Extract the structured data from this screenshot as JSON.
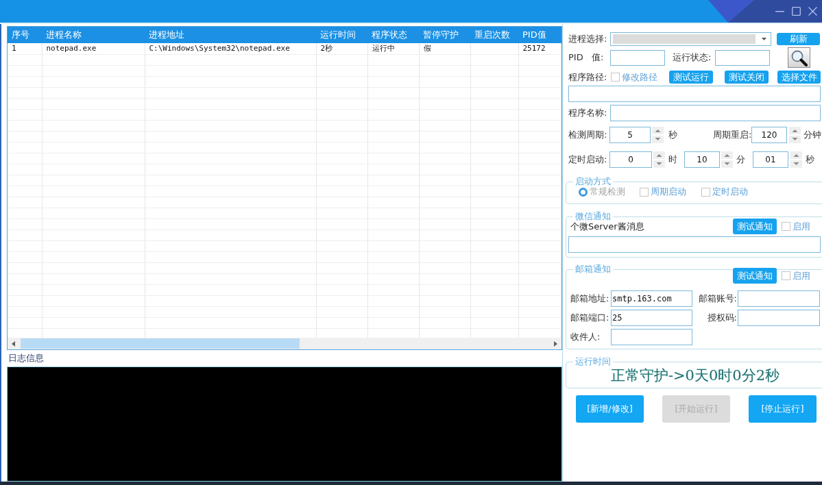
{
  "process_table": {
    "columns": [
      "序号",
      "进程名称",
      "进程地址",
      "运行时间",
      "程序状态",
      "暂停守护",
      "重启次数",
      "PID值"
    ],
    "rows": [
      [
        "1",
        "notepad.exe",
        "C:\\Windows\\System32\\notepad.exe",
        "2秒",
        "运行中",
        "假",
        null,
        "25172"
      ]
    ]
  },
  "log": {
    "label": "日志信息"
  },
  "settings": {
    "process_select": {
      "label": "进程选择:"
    },
    "refresh_button": "刷新",
    "pid": {
      "label": "PID   值:"
    },
    "run_status": {
      "label": "运行状态:"
    },
    "program_path": {
      "label": "程序路径:",
      "modify_path": {
        "label": "修改路径",
        "checked": false
      },
      "buttons": [
        "测试运行",
        "测试关闭",
        "选择文件"
      ]
    },
    "program_name": {
      "label": "程序名称:"
    },
    "check_interval": {
      "label": "检测周期:",
      "value": "5",
      "unit": "秒"
    },
    "periodic_restart": {
      "label": "周期重启:",
      "value": "120",
      "unit": "分钟"
    },
    "scheduled_start": {
      "label": "定时启动:",
      "fields": [
        {
          "value": "0",
          "unit": "时"
        },
        {
          "value": "10",
          "unit": "分"
        },
        {
          "value": "01",
          "unit": "秒"
        }
      ]
    }
  },
  "start_mode": {
    "title": "启动方式",
    "options": [
      {
        "kind": "radio",
        "label": "常规检测",
        "selected": true,
        "disabled": true
      },
      {
        "kind": "checkbox",
        "label": "周期启动",
        "checked": false,
        "disabled": false
      },
      {
        "kind": "checkbox",
        "label": "定时启动",
        "checked": false,
        "disabled": false
      }
    ]
  },
  "wechat_notify": {
    "title": "微信通知",
    "caption": "个微Server酱消息",
    "test_button": "测试通知",
    "enable": {
      "label": "启用",
      "checked": false
    }
  },
  "email_notify": {
    "title": "邮箱通知",
    "test_button": "测试通知",
    "enable": {
      "label": "启用",
      "checked": false
    },
    "fields": [
      {
        "label": "邮箱地址:",
        "value": "smtp.163.com"
      },
      {
        "label": "邮箱账号:"
      },
      {
        "label": "邮箱端口:",
        "value": "25"
      },
      {
        "label": "授权码:"
      },
      {
        "label": "收件人:"
      }
    ]
  },
  "run_time": {
    "title": "运行时间",
    "text": "正常守护->0天0时0分2秒"
  },
  "actions": [
    {
      "label": "[新增/修改]",
      "disabled": false
    },
    {
      "label": "[开始运行]",
      "disabled": true
    },
    {
      "label": "[停止运行]",
      "disabled": false
    }
  ]
}
